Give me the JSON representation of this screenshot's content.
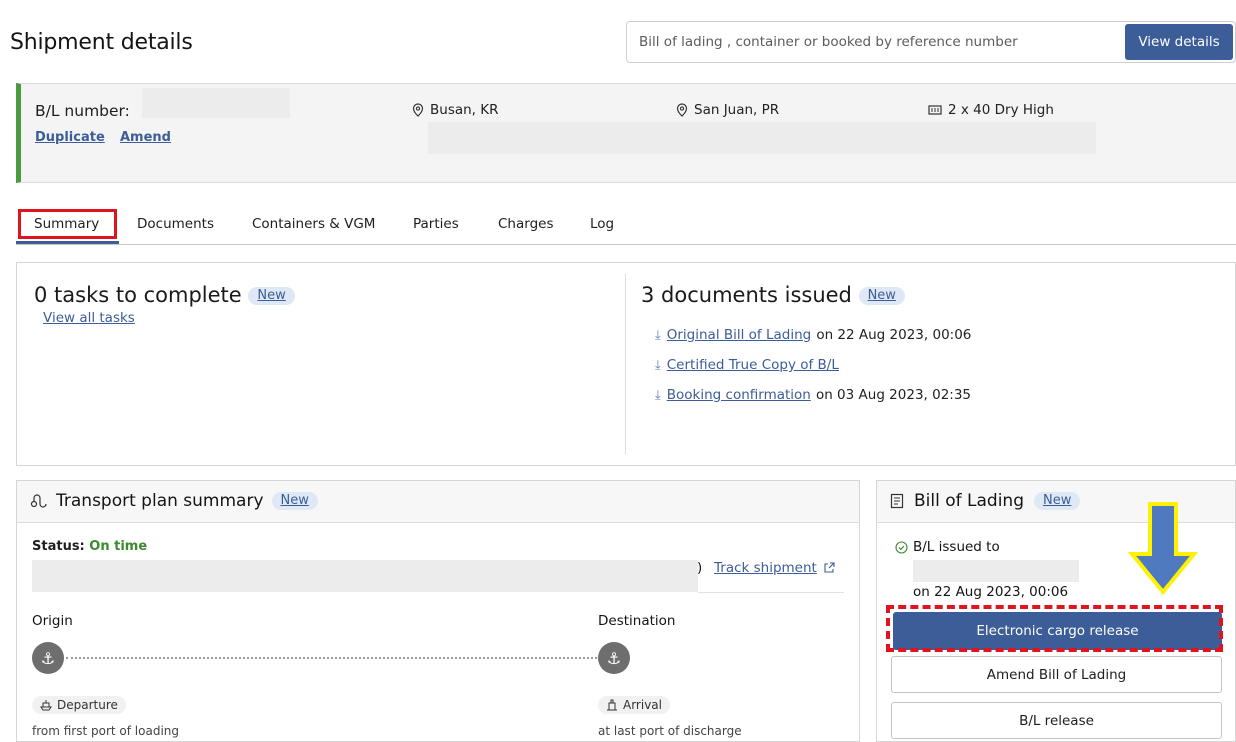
{
  "header": {
    "title": "Shipment details",
    "search_placeholder": "Bill of lading , container or booked by reference number",
    "view_details_label": "View details"
  },
  "shipment": {
    "bl_label": "B/L number:",
    "duplicate_label": "Duplicate",
    "amend_label": "Amend",
    "origin": "Busan, KR",
    "destination": "San Juan, PR",
    "equipment": "2 x 40 Dry High"
  },
  "tabs": [
    {
      "label": "Summary",
      "active": true
    },
    {
      "label": "Documents"
    },
    {
      "label": "Containers & VGM"
    },
    {
      "label": "Parties"
    },
    {
      "label": "Charges"
    },
    {
      "label": "Log"
    }
  ],
  "tasks": {
    "title": "0 tasks to complete",
    "badge": "New",
    "view_all": "View all tasks"
  },
  "documents": {
    "title": "3 documents issued",
    "badge": "New",
    "items": [
      {
        "link": "Original Bill of Lading",
        "date": "on 22 Aug 2023, 00:06"
      },
      {
        "link": "Certified True Copy of B/L",
        "date": ""
      },
      {
        "link": "Booking confirmation",
        "date": "on 03 Aug 2023, 02:35"
      }
    ]
  },
  "transport": {
    "title": "Transport plan summary",
    "badge": "New",
    "status_label": "Status:",
    "status_value": "On time",
    "paren": ")",
    "track_label": "Track shipment",
    "origin_label": "Origin",
    "destination_label": "Destination",
    "departure_label": "Departure",
    "departure_sub": "from first port of loading",
    "arrival_label": "Arrival",
    "arrival_sub": "at last port of discharge"
  },
  "bill": {
    "title": "Bill of Lading",
    "badge": "New",
    "issued_to": "B/L issued to",
    "issued_date": "on 22 Aug 2023, 00:06",
    "electronic_release": "Electronic cargo release",
    "amend": "Amend Bill of Lading",
    "release": "B/L release"
  },
  "colors": {
    "primary": "#3c5d97",
    "highlight_red": "#e0141e",
    "arrow_blue": "#4f7ac0",
    "arrow_yellow": "#fff200",
    "status_green": "#3a8a2e"
  }
}
